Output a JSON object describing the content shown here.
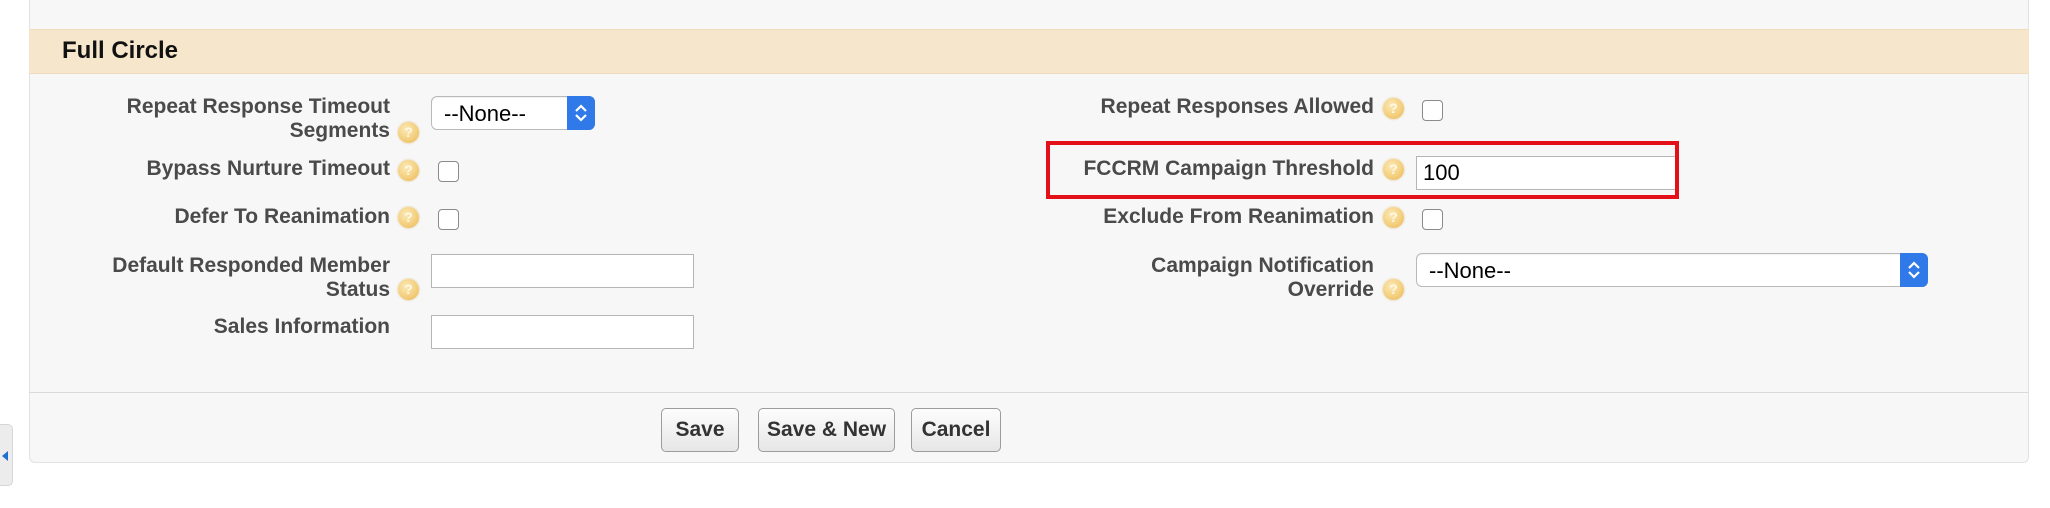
{
  "section": {
    "title": "Full Circle"
  },
  "left_fields": {
    "repeat_response_timeout_segments": {
      "label_line1": "Repeat Response Timeout",
      "label_line2": "Segments",
      "value": "--None--"
    },
    "bypass_nurture_timeout": {
      "label": "Bypass Nurture Timeout",
      "checked": false
    },
    "defer_to_reanimation": {
      "label": "Defer To Reanimation",
      "checked": false
    },
    "default_responded_member_status": {
      "label_line1": "Default Responded Member",
      "label_line2": "Status",
      "value": ""
    },
    "sales_information": {
      "label": "Sales Information",
      "value": ""
    }
  },
  "right_fields": {
    "repeat_responses_allowed": {
      "label": "Repeat Responses Allowed",
      "checked": false
    },
    "fccrm_campaign_threshold": {
      "label": "FCCRM Campaign Threshold",
      "value": "100"
    },
    "exclude_from_reanimation": {
      "label": "Exclude From Reanimation",
      "checked": false
    },
    "campaign_notification_override": {
      "label_line1": "Campaign Notification",
      "label_line2": "Override",
      "value": "--None--"
    }
  },
  "buttons": {
    "save": "Save",
    "save_new": "Save & New",
    "cancel": "Cancel"
  },
  "colors": {
    "section_bar": "#f5e6cc",
    "highlight": "#e3101a",
    "select_arrow": "#2f79e8"
  },
  "icons": {
    "help": "help-icon",
    "select": "chevron-updown-icon",
    "collapse": "collapse-left-icon"
  }
}
